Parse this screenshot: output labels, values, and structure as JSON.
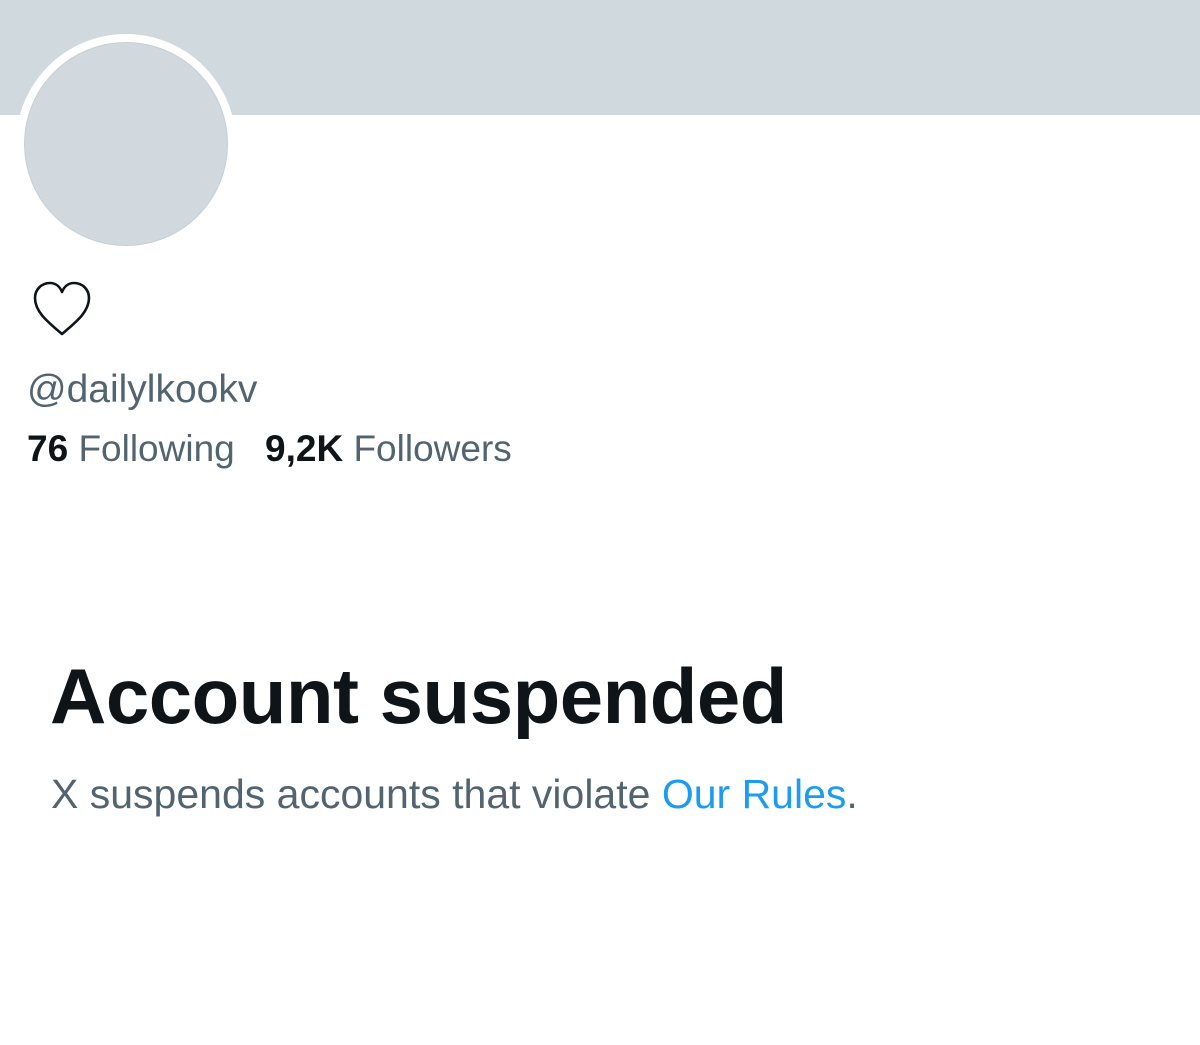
{
  "profile": {
    "display_name_icon": "heart-outline-icon",
    "handle": "@dailylkookv",
    "following_count": "76",
    "following_label": "Following",
    "followers_count": "9,2K",
    "followers_label": "Followers"
  },
  "suspension": {
    "title": "Account suspended",
    "message_prefix": "X suspends accounts that violate ",
    "rules_link": "Our Rules",
    "message_suffix": "."
  },
  "colors": {
    "banner": "#cfd9de",
    "avatar": "#d1d9de",
    "primary_text": "#0f1419",
    "secondary_text": "#536471",
    "link": "#1d9bf0"
  }
}
